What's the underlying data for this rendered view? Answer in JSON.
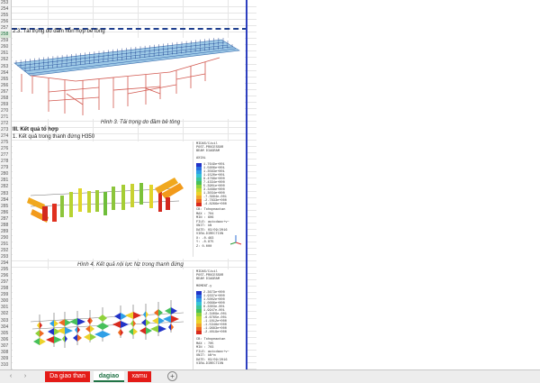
{
  "row_numbers": [
    "253",
    "254",
    "255",
    "256",
    "257",
    "258",
    "259",
    "260",
    "261",
    "262",
    "263",
    "264",
    "265",
    "266",
    "267",
    "268",
    "269",
    "270",
    "271",
    "272",
    "273",
    "274",
    "275",
    "276",
    "277",
    "278",
    "279",
    "280",
    "281",
    "282",
    "283",
    "284",
    "285",
    "286",
    "287",
    "288",
    "289",
    "290",
    "291",
    "292",
    "293",
    "294",
    "295",
    "296",
    "297",
    "298",
    "299",
    "300",
    "301",
    "302",
    "303",
    "304",
    "305",
    "306",
    "307",
    "308",
    "309",
    "310"
  ],
  "selected_row": "258",
  "section_2_3": "2.3. Tải trọng  do đầm hỗn hợp bê tông",
  "caption_3": "Hình 3. Tải trọng do đầm bê tông",
  "heading_iii": "III. Kết quả tổ hợp",
  "sub_1": "1. Kết quả trong thanh đứng H350",
  "caption_4": "Hình 4. Kết quả nội lực Nz trong thanh đứng",
  "legend1": {
    "lines": [
      "MIDAS/Civil",
      "POST-PROCESSOR",
      "BEAM DIAGRAM",
      "",
      "AXIAL"
    ],
    "values": [
      "1.7649e+001",
      "1.5606e+001",
      "1.3563e+001",
      "1.1520e+001",
      "9.4768e+000",
      "7.4334e+000",
      "5.3901e+000",
      "3.3468e+000",
      "1.3034e+000",
      "-7.3994e-001",
      "-2.7833e+000",
      "-4.8266e+000"
    ],
    "footer": [
      "CB: Tohopmaxtan",
      "MAX : 704",
      "MIN : 606",
      "FILE: autodaoc+v~",
      "UNIT: kN",
      "DATE: 03/09/2016",
      "VIEW-DIRECTION",
      "X: -0.483",
      "Y: -0.875",
      "Z: 0.000"
    ]
  },
  "legend2": {
    "lines": [
      "MIDAS/Civil",
      "POST-PROCESSOR",
      "BEAM DIAGRAM",
      "",
      "MOMENT-y"
    ],
    "values": [
      "2.3673e+000",
      "1.9337e+000",
      "1.5002e+000",
      "1.0666e+000",
      "6.3303e-001",
      "1.9947e-001",
      "-2.3409e-001",
      "-6.6765e-001",
      "-1.1012e+000",
      "-1.5348e+000",
      "-1.9683e+000",
      "-2.4019e+000"
    ],
    "footer": [
      "CB: Tohopmaxtan",
      "MAX : 705",
      "MIN : 703",
      "FILE: autodaoc+v~",
      "UNIT: kN*m",
      "DATE: 03/09/2016",
      "VIEW-DIRECTION"
    ]
  },
  "tabs": [
    "Da giao than",
    "dagiao",
    "xamu"
  ],
  "active_tab": "dagiao",
  "nav_prev": "‹",
  "nav_next": "›",
  "add_sheet": "+",
  "colors": {
    "tab_red": "#e41b17",
    "excel_green": "#217346",
    "page_break_blue": "#2d3fbf"
  }
}
